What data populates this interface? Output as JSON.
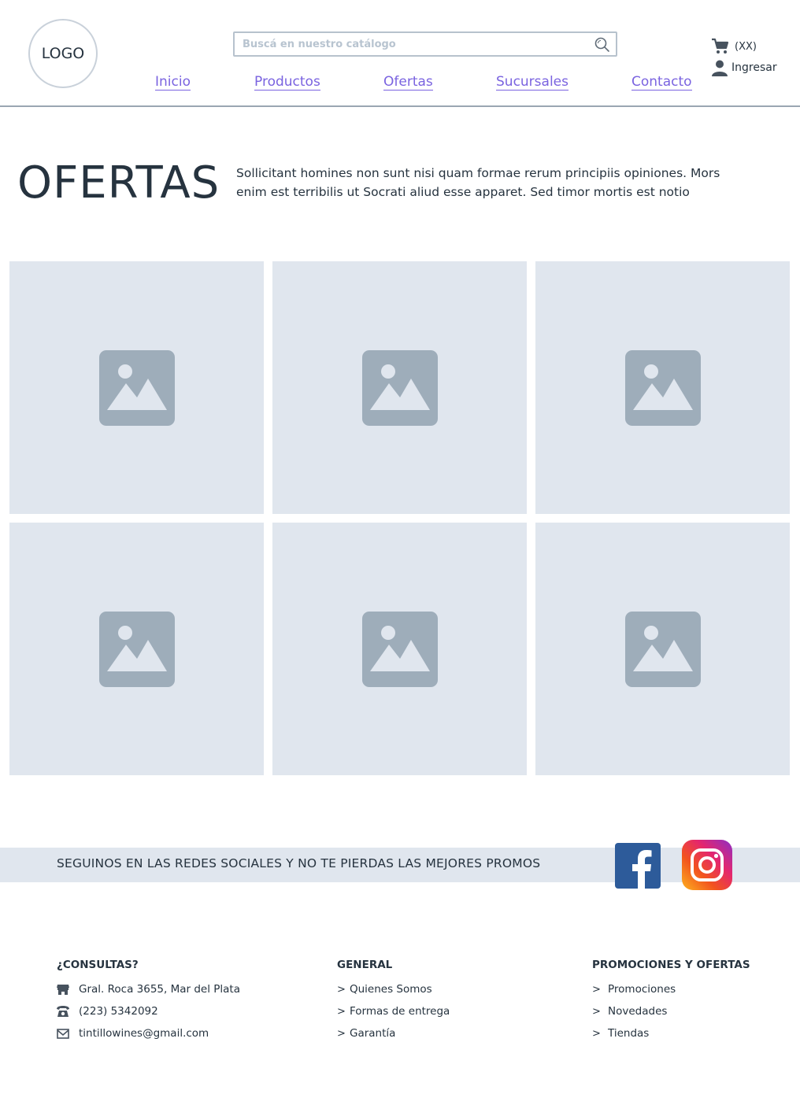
{
  "header": {
    "logo_text": "LOGO",
    "search_placeholder": "Buscá en nuestro catálogo",
    "cart_count": "(XX)",
    "login_label": "Ingresar"
  },
  "nav": {
    "items": [
      {
        "label": "Inicio"
      },
      {
        "label": "Productos"
      },
      {
        "label": "Ofertas"
      },
      {
        "label": "Sucursales"
      },
      {
        "label": "Contacto"
      }
    ],
    "color": "#7a63e0"
  },
  "hero": {
    "title": "OFERTAS",
    "text": "Sollicitant homines non sunt nisi quam formae rerum principiis opiniones. Mors enim est terribilis ut Socrati aliud esse apparet. Sed timor mortis est notio"
  },
  "products": {
    "tiles": [
      {
        "icon": "image-placeholder-icon"
      },
      {
        "icon": "image-placeholder-icon"
      },
      {
        "icon": "image-placeholder-icon"
      },
      {
        "icon": "image-placeholder-icon"
      },
      {
        "icon": "image-placeholder-icon"
      },
      {
        "icon": "image-placeholder-icon"
      }
    ]
  },
  "social": {
    "text": "SEGUINOS EN LAS REDES SOCIALES Y NO TE PIERDAS LAS MEJORES PROMOS",
    "facebook_color": "#2d5b9a"
  },
  "footer": {
    "contact": {
      "title": "¿CONSULTAS?",
      "address": "Gral. Roca 3655, Mar del Plata",
      "phone": "(223) 5342092",
      "email": "tintillowines@gmail.com"
    },
    "general": {
      "title": "GENERAL",
      "links": [
        "Quienes Somos",
        "Formas de entrega",
        "Garantía"
      ]
    },
    "promos": {
      "title": "PROMOCIONES Y OFERTAS",
      "links": [
        "Promociones",
        "Novedades",
        "Tiendas"
      ]
    },
    "chevron": ">"
  }
}
